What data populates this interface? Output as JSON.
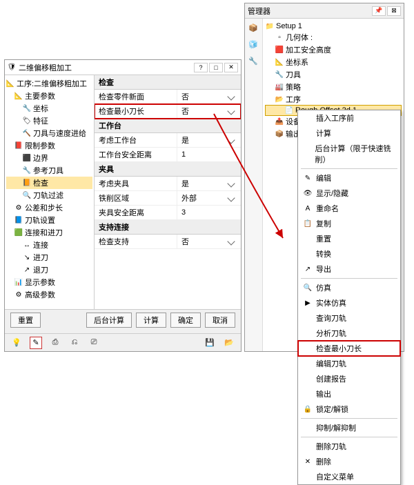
{
  "dialog": {
    "title": "二维偏移粗加工",
    "root": "工序:二维偏移粗加工",
    "tree": [
      {
        "lvl": 0,
        "ico": "📐",
        "txt": "主要参数"
      },
      {
        "lvl": 1,
        "ico": "🔧",
        "txt": "坐标"
      },
      {
        "lvl": 1,
        "ico": "🏷",
        "txt": "特征"
      },
      {
        "lvl": 1,
        "ico": "🔨",
        "txt": "刀具与速度进给"
      },
      {
        "lvl": 0,
        "ico": "📕",
        "txt": "限制参数"
      },
      {
        "lvl": 1,
        "ico": "⬛",
        "txt": "边界"
      },
      {
        "lvl": 1,
        "ico": "🔧",
        "txt": "参考刀具"
      },
      {
        "lvl": 1,
        "ico": "📙",
        "txt": "检查",
        "sel": true
      },
      {
        "lvl": 1,
        "ico": "🔍",
        "txt": "刀轨过滤"
      },
      {
        "lvl": 0,
        "ico": "⚙",
        "txt": "公差和步长"
      },
      {
        "lvl": 0,
        "ico": "📘",
        "txt": "刀轨设置"
      },
      {
        "lvl": 0,
        "ico": "🟩",
        "txt": "连接和进刀"
      },
      {
        "lvl": 1,
        "ico": "↔",
        "txt": "连接"
      },
      {
        "lvl": 1,
        "ico": "↘",
        "txt": "进刀"
      },
      {
        "lvl": 1,
        "ico": "↗",
        "txt": "退刀"
      },
      {
        "lvl": 0,
        "ico": "📊",
        "txt": "显示参数"
      },
      {
        "lvl": 0,
        "ico": "⚙",
        "txt": "高级参数"
      }
    ],
    "groups": [
      {
        "title": "检查",
        "rows": [
          {
            "k": "检查零件新面",
            "v": "否",
            "dd": true,
            "hl": false
          },
          {
            "k": "检查最小刀长",
            "v": "否",
            "dd": true,
            "hl": true
          }
        ]
      },
      {
        "title": "工作台",
        "rows": [
          {
            "k": "考虑工作台",
            "v": "是",
            "dd": true
          },
          {
            "k": "工作台安全距离",
            "v": "1",
            "dd": false
          }
        ]
      },
      {
        "title": "夹具",
        "rows": [
          {
            "k": "考虑夹具",
            "v": "是",
            "dd": true
          },
          {
            "k": "铁削区域",
            "v": "外部",
            "dd": true
          },
          {
            "k": "夹具安全距离",
            "v": "3",
            "dd": false
          }
        ]
      },
      {
        "title": "支持连接",
        "rows": [
          {
            "k": "检查支持",
            "v": "否",
            "dd": true
          }
        ]
      }
    ],
    "buttons": {
      "reset": "重置",
      "bg": "后台计算",
      "calc": "计算",
      "ok": "确定",
      "cancel": "取消"
    }
  },
  "manager": {
    "title": "管理器",
    "tree": [
      {
        "lvl": 0,
        "ico": "📁",
        "txt": "Setup 1"
      },
      {
        "lvl": 1,
        "ico": "▫",
        "txt": "几何体 :"
      },
      {
        "lvl": 1,
        "ico": "🟥",
        "txt": "加工安全高度"
      },
      {
        "lvl": 1,
        "ico": "📐",
        "txt": "坐标系"
      },
      {
        "lvl": 1,
        "ico": "🔧",
        "txt": "刀具"
      },
      {
        "lvl": 1,
        "ico": "🏭",
        "txt": "策略"
      },
      {
        "lvl": 1,
        "ico": "📂",
        "txt": "工序"
      },
      {
        "lvl": 2,
        "ico": "📄",
        "txt": "Rough Offset 2d 1",
        "sel": true
      },
      {
        "lvl": 1,
        "ico": "📤",
        "txt": "设备 (unde"
      },
      {
        "lvl": 1,
        "ico": "📦",
        "txt": "输出"
      }
    ],
    "menu": [
      {
        "ico": "",
        "txt": "插入工序前"
      },
      {
        "ico": "",
        "txt": "计算"
      },
      {
        "ico": "",
        "txt": "后台计算（限于快速铣削）"
      },
      {
        "sep": true
      },
      {
        "ico": "✎",
        "txt": "编辑"
      },
      {
        "ico": "👁",
        "txt": "显示/隐藏"
      },
      {
        "ico": "A",
        "txt": "重命名"
      },
      {
        "ico": "📋",
        "txt": "复制"
      },
      {
        "ico": "",
        "txt": "重置"
      },
      {
        "ico": "",
        "txt": "转换"
      },
      {
        "ico": "↗",
        "txt": "导出"
      },
      {
        "sep": true
      },
      {
        "ico": "🔍",
        "txt": "仿真"
      },
      {
        "ico": "▶",
        "txt": "实体仿真"
      },
      {
        "ico": "",
        "txt": "查询刀轨"
      },
      {
        "ico": "",
        "txt": "分析刀轨"
      },
      {
        "ico": "",
        "txt": "检查最小刀长",
        "hl": true
      },
      {
        "ico": "",
        "txt": "编辑刀轨"
      },
      {
        "ico": "",
        "txt": "创建报告"
      },
      {
        "ico": "",
        "txt": "输出"
      },
      {
        "ico": "🔒",
        "txt": "锁定/解锁"
      },
      {
        "sep": true
      },
      {
        "ico": "",
        "txt": "抑制/解抑制"
      },
      {
        "sep": true
      },
      {
        "ico": "",
        "txt": "删除刀轨"
      },
      {
        "ico": "✕",
        "txt": "删除"
      },
      {
        "ico": "",
        "txt": "自定义菜单"
      }
    ]
  }
}
